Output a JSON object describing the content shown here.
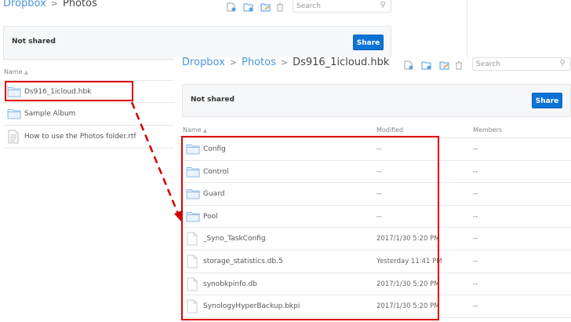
{
  "back_panel": {
    "breadcrumb": [
      "Dropbox",
      "Photos"
    ],
    "search_placeholder": "Search",
    "sharing_status": "Not shared",
    "share_label": "Share",
    "column_name": "Name",
    "items": [
      {
        "name": "Ds916_1icloud.hbk",
        "type": "folder"
      },
      {
        "name": "Sample Album",
        "type": "folder"
      },
      {
        "name": "How to use the Photos folder.rtf",
        "type": "document"
      }
    ]
  },
  "front_panel": {
    "breadcrumb": [
      "Dropbox",
      "Photos",
      "Ds916_1icloud.hbk"
    ],
    "search_placeholder": "Search",
    "sharing_status": "Not shared",
    "share_label": "Share",
    "columns": {
      "name": "Name",
      "modified": "Modified",
      "members": "Members"
    },
    "items": [
      {
        "name": "Config",
        "type": "folder",
        "modified": "--",
        "members": "--"
      },
      {
        "name": "Control",
        "type": "folder",
        "modified": "--",
        "members": "--"
      },
      {
        "name": "Guard",
        "type": "folder",
        "modified": "--",
        "members": "--"
      },
      {
        "name": "Pool",
        "type": "folder",
        "modified": "--",
        "members": "--"
      },
      {
        "name": "_Syno_TaskConfig",
        "type": "file",
        "modified": "2017/1/30 5:20 PM",
        "members": "--"
      },
      {
        "name": "storage_statistics.db.5",
        "type": "file",
        "modified": "Yesterday 11:41 PM",
        "members": "--"
      },
      {
        "name": "synobkpinfo.db",
        "type": "file",
        "modified": "2017/1/30 5:20 PM",
        "members": "--"
      },
      {
        "name": "SynologyHyperBackup.bkpi",
        "type": "file",
        "modified": "2017/1/30 5:20 PM",
        "members": "--"
      }
    ]
  },
  "colors": {
    "accent": "#0c73d6",
    "link": "#4a94d9",
    "highlight": "#e00000"
  }
}
